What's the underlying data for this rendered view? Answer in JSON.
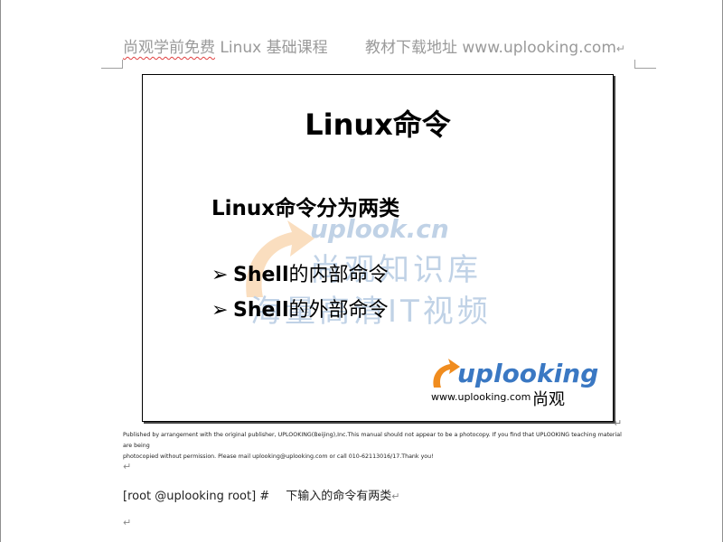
{
  "header": {
    "left_text_underlined": "尚观学前免费",
    "left_text_rest": " Linux 基础课程",
    "right_text": "教材下载地址 www.uplooking.com",
    "para_mark": "↵"
  },
  "slide": {
    "title": "Linux命令",
    "subtitle": "Linux命令分为两类",
    "bullets": [
      {
        "arrow": "➢",
        "bold": "Shell",
        "rest": "的内部命令"
      },
      {
        "arrow": "➢",
        "bold": "Shell",
        "rest": "的外部命令"
      }
    ],
    "watermark": {
      "line1": "uplook.cn",
      "line2": "尚观知识库",
      "line3": "海量高清IT视频"
    },
    "brand": {
      "name": "uplooking",
      "url": "www.uplooking.com",
      "cn": "尚观",
      "accent": "#f08c1e",
      "blue": "#3a78c3"
    }
  },
  "end_mark": "↵",
  "notice": {
    "line1": "Published by arrangement with the original publisher, UPLOOKING(Beijing),Inc.This manual should not appear to be a photocopy. If you find that UPLOOKING teaching material are being",
    "line2": "photocopied without permission. Please mail uplooking@uplooking.com or call 010-62113016/17.Thank you!"
  },
  "para_marks": {
    "empty1": "↵",
    "empty2": "↵"
  },
  "command": {
    "prompt": "[root @uplooking root] #",
    "description": "下输入的命令有两类",
    "mark": "↵"
  }
}
